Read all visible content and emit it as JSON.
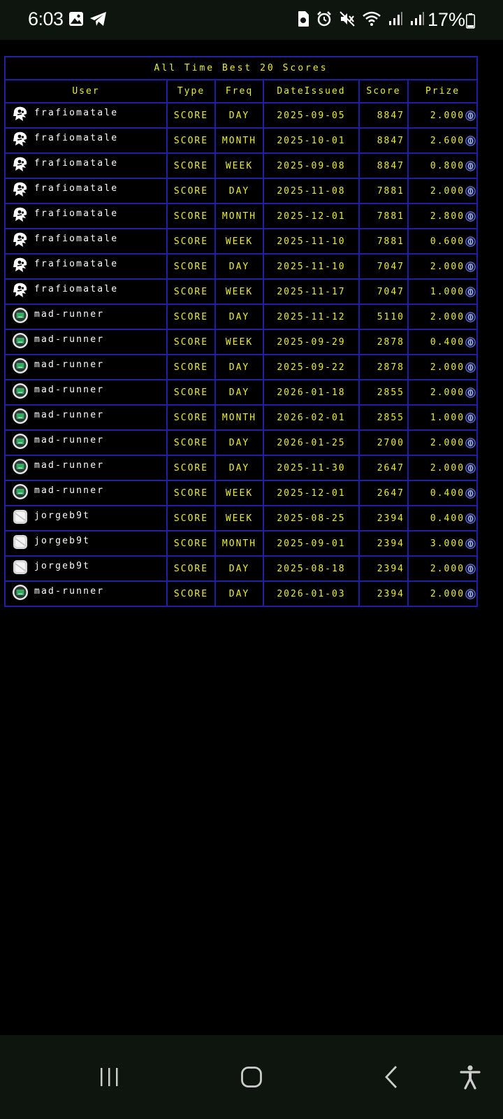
{
  "status_bar": {
    "time": "6:03",
    "battery_percent": "17%",
    "icons": [
      "image-icon",
      "telegram-icon",
      "sim-icon",
      "alarm-icon",
      "mute-icon",
      "wifi-icon",
      "signal-icon",
      "signal-icon",
      "battery-icon"
    ]
  },
  "leaderboard": {
    "title": "All Time Best 20 Scores",
    "columns": [
      "User",
      "Type",
      "Freq",
      "DateIssued",
      "Score",
      "Prize"
    ],
    "rows": [
      {
        "user": "frafiomatale",
        "avatar": "ghost-avatar",
        "type": "SCORE",
        "freq": "DAY",
        "date": "2025-09-05",
        "score": "8847",
        "prize": "2.000"
      },
      {
        "user": "frafiomatale",
        "avatar": "ghost-avatar",
        "type": "SCORE",
        "freq": "MONTH",
        "date": "2025-10-01",
        "score": "8847",
        "prize": "2.600"
      },
      {
        "user": "frafiomatale",
        "avatar": "ghost-avatar",
        "type": "SCORE",
        "freq": "WEEK",
        "date": "2025-09-08",
        "score": "8847",
        "prize": "0.800"
      },
      {
        "user": "frafiomatale",
        "avatar": "ghost-avatar",
        "type": "SCORE",
        "freq": "DAY",
        "date": "2025-11-08",
        "score": "7881",
        "prize": "2.000"
      },
      {
        "user": "frafiomatale",
        "avatar": "ghost-avatar",
        "type": "SCORE",
        "freq": "MONTH",
        "date": "2025-12-01",
        "score": "7881",
        "prize": "2.800"
      },
      {
        "user": "frafiomatale",
        "avatar": "ghost-avatar",
        "type": "SCORE",
        "freq": "WEEK",
        "date": "2025-11-10",
        "score": "7881",
        "prize": "0.600"
      },
      {
        "user": "frafiomatale",
        "avatar": "ghost-avatar",
        "type": "SCORE",
        "freq": "DAY",
        "date": "2025-11-10",
        "score": "7047",
        "prize": "2.000"
      },
      {
        "user": "frafiomatale",
        "avatar": "ghost-avatar",
        "type": "SCORE",
        "freq": "WEEK",
        "date": "2025-11-17",
        "score": "7047",
        "prize": "1.000"
      },
      {
        "user": "mad-runner",
        "avatar": "robot-avatar",
        "type": "SCORE",
        "freq": "DAY",
        "date": "2025-11-12",
        "score": "5110",
        "prize": "2.000"
      },
      {
        "user": "mad-runner",
        "avatar": "robot-avatar",
        "type": "SCORE",
        "freq": "WEEK",
        "date": "2025-09-29",
        "score": "2878",
        "prize": "0.400"
      },
      {
        "user": "mad-runner",
        "avatar": "robot-avatar",
        "type": "SCORE",
        "freq": "DAY",
        "date": "2025-09-22",
        "score": "2878",
        "prize": "2.000"
      },
      {
        "user": "mad-runner",
        "avatar": "robot-avatar",
        "type": "SCORE",
        "freq": "DAY",
        "date": "2026-01-18",
        "score": "2855",
        "prize": "2.000"
      },
      {
        "user": "mad-runner",
        "avatar": "robot-avatar",
        "type": "SCORE",
        "freq": "MONTH",
        "date": "2026-02-01",
        "score": "2855",
        "prize": "1.000"
      },
      {
        "user": "mad-runner",
        "avatar": "robot-avatar",
        "type": "SCORE",
        "freq": "DAY",
        "date": "2026-01-25",
        "score": "2700",
        "prize": "2.000"
      },
      {
        "user": "mad-runner",
        "avatar": "robot-avatar",
        "type": "SCORE",
        "freq": "DAY",
        "date": "2025-11-30",
        "score": "2647",
        "prize": "2.000"
      },
      {
        "user": "mad-runner",
        "avatar": "robot-avatar",
        "type": "SCORE",
        "freq": "WEEK",
        "date": "2025-12-01",
        "score": "2647",
        "prize": "0.400"
      },
      {
        "user": "jorgeb9t",
        "avatar": "cube-avatar",
        "type": "SCORE",
        "freq": "WEEK",
        "date": "2025-08-25",
        "score": "2394",
        "prize": "0.400"
      },
      {
        "user": "jorgeb9t",
        "avatar": "cube-avatar",
        "type": "SCORE",
        "freq": "MONTH",
        "date": "2025-09-01",
        "score": "2394",
        "prize": "3.000"
      },
      {
        "user": "jorgeb9t",
        "avatar": "cube-avatar",
        "type": "SCORE",
        "freq": "DAY",
        "date": "2025-08-18",
        "score": "2394",
        "prize": "2.000"
      },
      {
        "user": "mad-runner",
        "avatar": "robot-avatar",
        "type": "SCORE",
        "freq": "DAY",
        "date": "2026-01-03",
        "score": "2394",
        "prize": "2.000"
      }
    ]
  },
  "nav_bar": {
    "buttons": [
      "recents-icon",
      "home-icon",
      "back-icon",
      "accessibility-icon"
    ]
  },
  "colors": {
    "table_text": "#ecec2c",
    "table_border": "#1e1ea6",
    "user_text": "#ffffff",
    "background": "#000000",
    "bars": "#0d150e"
  }
}
